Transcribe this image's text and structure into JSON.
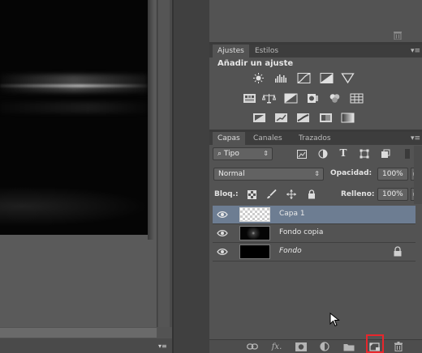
{
  "top_panel": {
    "trash_icon": "trash-icon"
  },
  "adjustments": {
    "tabs": [
      {
        "label": "Ajustes",
        "active": true
      },
      {
        "label": "Estilos",
        "active": false
      }
    ],
    "title": "Añadir un ajuste",
    "row1": [
      "brightness-contrast-icon",
      "levels-icon",
      "curves-icon",
      "exposure-icon",
      "gradient-triangle-icon"
    ],
    "row2": [
      "vibrance-icon",
      "color-balance-icon",
      "black-white-icon",
      "photo-filter-icon",
      "channel-mixer-icon",
      "color-lookup-icon"
    ],
    "row3": [
      "invert-icon",
      "posterize-icon",
      "threshold-icon",
      "selective-color-icon",
      "gradient-map-icon"
    ]
  },
  "layers": {
    "tabs": [
      {
        "label": "Capas",
        "active": true
      },
      {
        "label": "Canales",
        "active": false
      },
      {
        "label": "Trazados",
        "active": false
      }
    ],
    "filter_kind": "Tipo",
    "blend_mode": "Normal",
    "opacity_label": "Opacidad:",
    "opacity_value": "100%",
    "lock_label": "Bloq.:",
    "fill_label": "Relleno:",
    "fill_value": "100%",
    "items": [
      {
        "name": "Capa 1",
        "selected": true,
        "locked": false,
        "italic": false,
        "thumb": "transparent"
      },
      {
        "name": "Fondo copia",
        "selected": false,
        "locked": false,
        "italic": false,
        "thumb": "dark-sparkle"
      },
      {
        "name": "Fondo",
        "selected": false,
        "locked": true,
        "italic": true,
        "thumb": "black"
      }
    ],
    "bottom_icons": [
      "link-icon",
      "fx-icon",
      "mask-icon",
      "adjustment-layer-icon",
      "folder-icon",
      "new-layer-icon",
      "trash-icon"
    ],
    "highlighted_icon": "new-layer-icon"
  },
  "colors": {
    "selection_highlight": "#6d7d92",
    "red_box": "#e8262c",
    "panel_bg": "#535353"
  }
}
